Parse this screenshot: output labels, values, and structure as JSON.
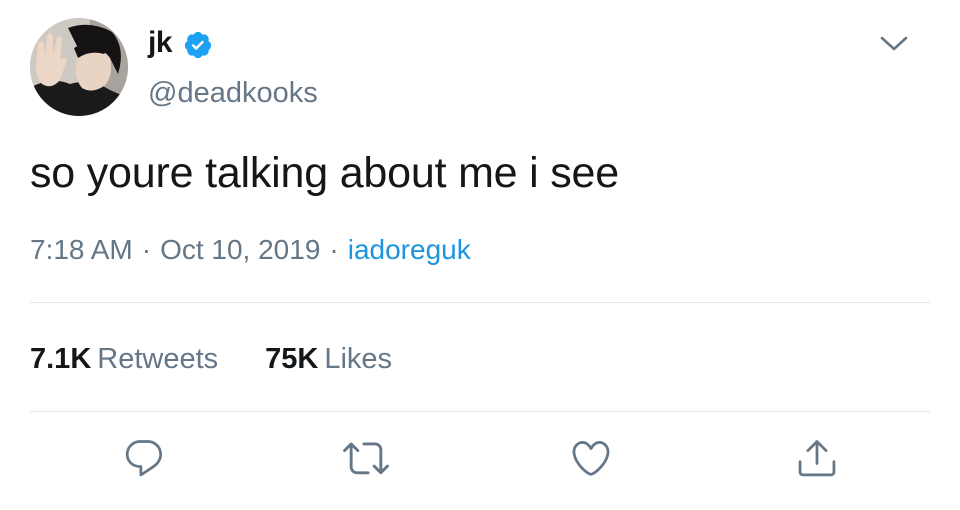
{
  "user": {
    "display_name": "jk",
    "handle": "@deadkooks",
    "verified": true,
    "avatar_icon": "profile-photo"
  },
  "tweet": {
    "text": "so youre talking about me i see",
    "time": "7:18 AM",
    "date": "Oct 10, 2019",
    "separator": "·",
    "source": "iadoreguk"
  },
  "stats": {
    "retweets_count": "7.1K",
    "retweets_label": "Retweets",
    "likes_count": "75K",
    "likes_label": "Likes"
  },
  "actions": [
    {
      "icon": "reply-icon"
    },
    {
      "icon": "retweet-icon"
    },
    {
      "icon": "like-icon"
    },
    {
      "icon": "share-icon"
    }
  ],
  "colors": {
    "text": "#14171a",
    "secondary": "#657786",
    "link": "#1b95e0",
    "verified": "#1da1f2",
    "divider": "#e1e8ed"
  }
}
